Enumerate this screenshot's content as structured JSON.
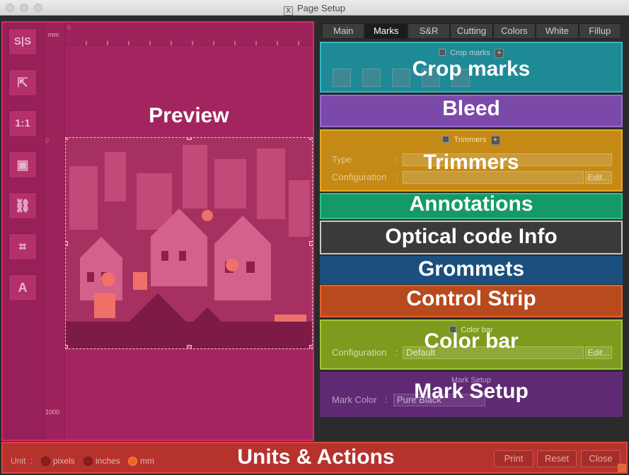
{
  "window": {
    "title": "Page Setup"
  },
  "preview": {
    "label": "Preview",
    "ruler_unit": "mm",
    "ruler_h_zero": "0",
    "ruler_v_zero": "0",
    "ruler_v_1000": "1000",
    "tools": [
      {
        "name": "split-view-icon",
        "glyph": "S|S"
      },
      {
        "name": "open-external-icon",
        "glyph": "⇱"
      },
      {
        "name": "actual-size-icon",
        "glyph": "1:1"
      },
      {
        "name": "fit-frame-icon",
        "glyph": "▣"
      },
      {
        "name": "link-icon",
        "glyph": "⛓"
      },
      {
        "name": "transform-icon",
        "glyph": "⌗"
      },
      {
        "name": "text-tool-icon",
        "glyph": "A"
      }
    ]
  },
  "tabs": [
    {
      "label": "Main",
      "active": false
    },
    {
      "label": "Marks",
      "active": true
    },
    {
      "label": "S&R",
      "active": false
    },
    {
      "label": "Cutting",
      "active": false
    },
    {
      "label": "Colors",
      "active": false
    },
    {
      "label": "White",
      "active": false
    },
    {
      "label": "Fillup",
      "active": false
    }
  ],
  "sections": {
    "crop_marks": {
      "label": "Crop marks",
      "header": "Crop marks",
      "color": "#1e8a96"
    },
    "bleed": {
      "label": "Bleed",
      "color": "#7b4aa8"
    },
    "trimmers": {
      "label": "Trimmers",
      "header": "Trimmers",
      "type_label": "Type",
      "config_label": "Configuration",
      "edit": "Edit...",
      "color": "#c58a15"
    },
    "annotations": {
      "label": "Annotations",
      "color": "#159a67"
    },
    "optical_code": {
      "label": "Optical code Info",
      "color": "#3a3a3a"
    },
    "grommets": {
      "label": "Grommets",
      "color": "#1a4f7e"
    },
    "control_strip": {
      "label": "Control Strip",
      "color": "#b84a1e"
    },
    "color_bar": {
      "label": "Color bar",
      "header": "Color bar",
      "config_label": "Configuration",
      "config_value": "Default",
      "edit": "Edit...",
      "color": "#7e9b1e"
    },
    "mark_setup": {
      "label": "Mark Setup",
      "header": "Mark Setup",
      "mark_color_label": "Mark Color",
      "mark_color_value": "Pure Black",
      "color": "#5f2a73"
    }
  },
  "bottom": {
    "label": "Units & Actions",
    "unit_label": "Unit",
    "units": [
      {
        "label": "pixels",
        "selected": false
      },
      {
        "label": "inches",
        "selected": false
      },
      {
        "label": "mm",
        "selected": true
      }
    ],
    "print": "Print",
    "reset": "Reset",
    "close": "Close"
  }
}
